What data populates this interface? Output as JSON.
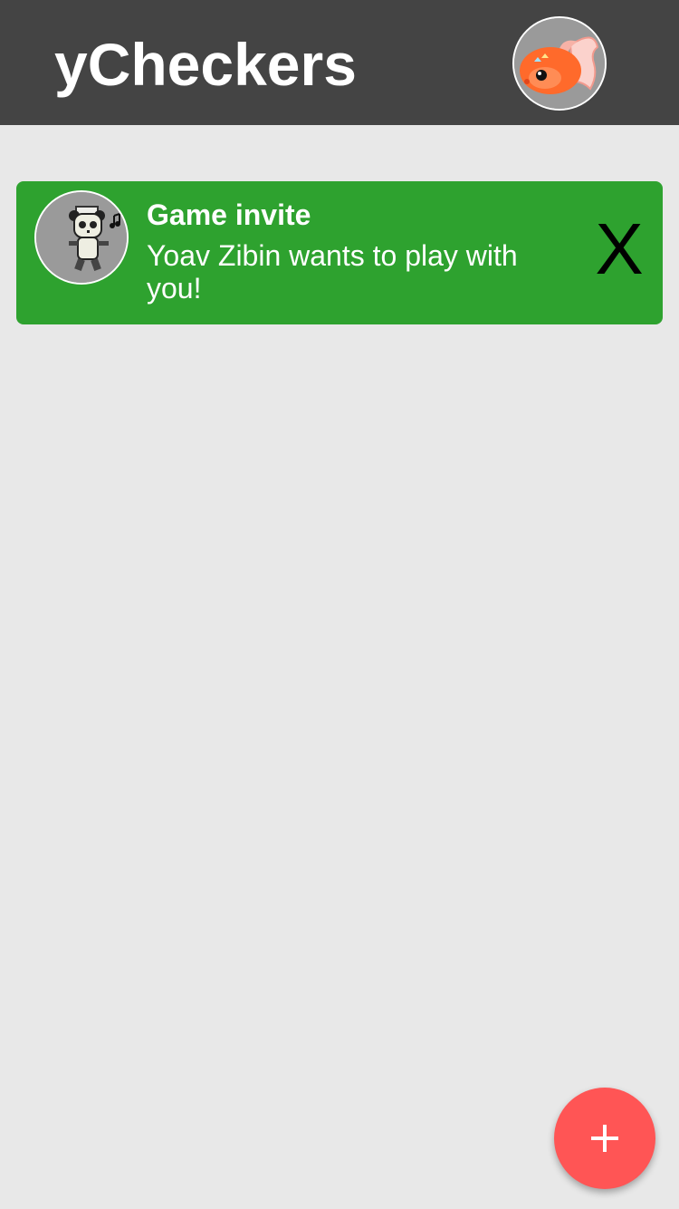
{
  "app_bar": {
    "title": "yCheckers",
    "background_color": "#444444",
    "profile_avatar_icon": "goldfish-avatar-icon"
  },
  "notifications": [
    {
      "title": "Game invite",
      "message": "Yoav Zibin wants to play with you!",
      "dismiss_label": "X",
      "avatar_icon": "panda-avatar-icon",
      "background_color": "#2ea22f"
    }
  ],
  "fab": {
    "icon": "plus-icon",
    "background_color": "#ff5555"
  },
  "page_background": "#e8e8e8"
}
